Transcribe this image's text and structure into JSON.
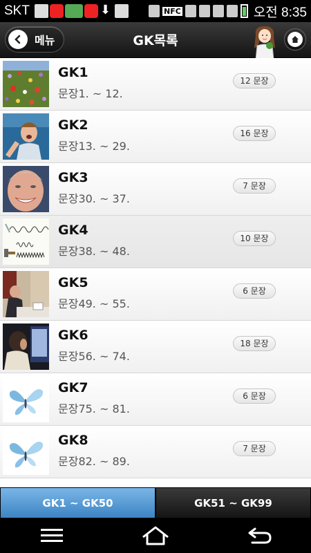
{
  "status_bar": {
    "carrier": "SKT",
    "nfc": "NFC",
    "time": "오전 8:35"
  },
  "header": {
    "menu_label": "메뉴",
    "title": "GK목록"
  },
  "list": [
    {
      "title": "GK1",
      "subtitle": "문장1. ~ 12.",
      "badge": "12 문장",
      "thumb": "flowers"
    },
    {
      "title": "GK2",
      "subtitle": "문장13. ~ 29.",
      "badge": "16 문장",
      "thumb": "man-shouting"
    },
    {
      "title": "GK3",
      "subtitle": "문장30. ~ 37.",
      "badge": "7 문장",
      "thumb": "smiling-man"
    },
    {
      "title": "GK4",
      "subtitle": "문장38. ~ 48.",
      "badge": "10 문장",
      "thumb": "sound-wave-diagram"
    },
    {
      "title": "GK5",
      "subtitle": "문장49. ~ 55.",
      "badge": "6 문장",
      "thumb": "man-at-desk"
    },
    {
      "title": "GK6",
      "subtitle": "문장56. ~ 74.",
      "badge": "18 문장",
      "thumb": "person-at-computer"
    },
    {
      "title": "GK7",
      "subtitle": "문장75. ~ 81.",
      "badge": "6 문장",
      "thumb": "butterfly"
    },
    {
      "title": "GK8",
      "subtitle": "문장82. ~ 89.",
      "badge": "7 문장",
      "thumb": "butterfly"
    }
  ],
  "tabs": [
    {
      "label": "GK1 ~ GK50",
      "active": true
    },
    {
      "label": "GK51 ~ GK99",
      "active": false
    }
  ],
  "icons": {
    "back": "chevron-left-icon",
    "home": "home-icon",
    "nav_menu": "menu-icon",
    "nav_home": "home-outline-icon",
    "nav_back": "back-arrow-icon"
  },
  "colors": {
    "tab_active": "#4a90d0",
    "header_bg": "#1e1e1e"
  }
}
